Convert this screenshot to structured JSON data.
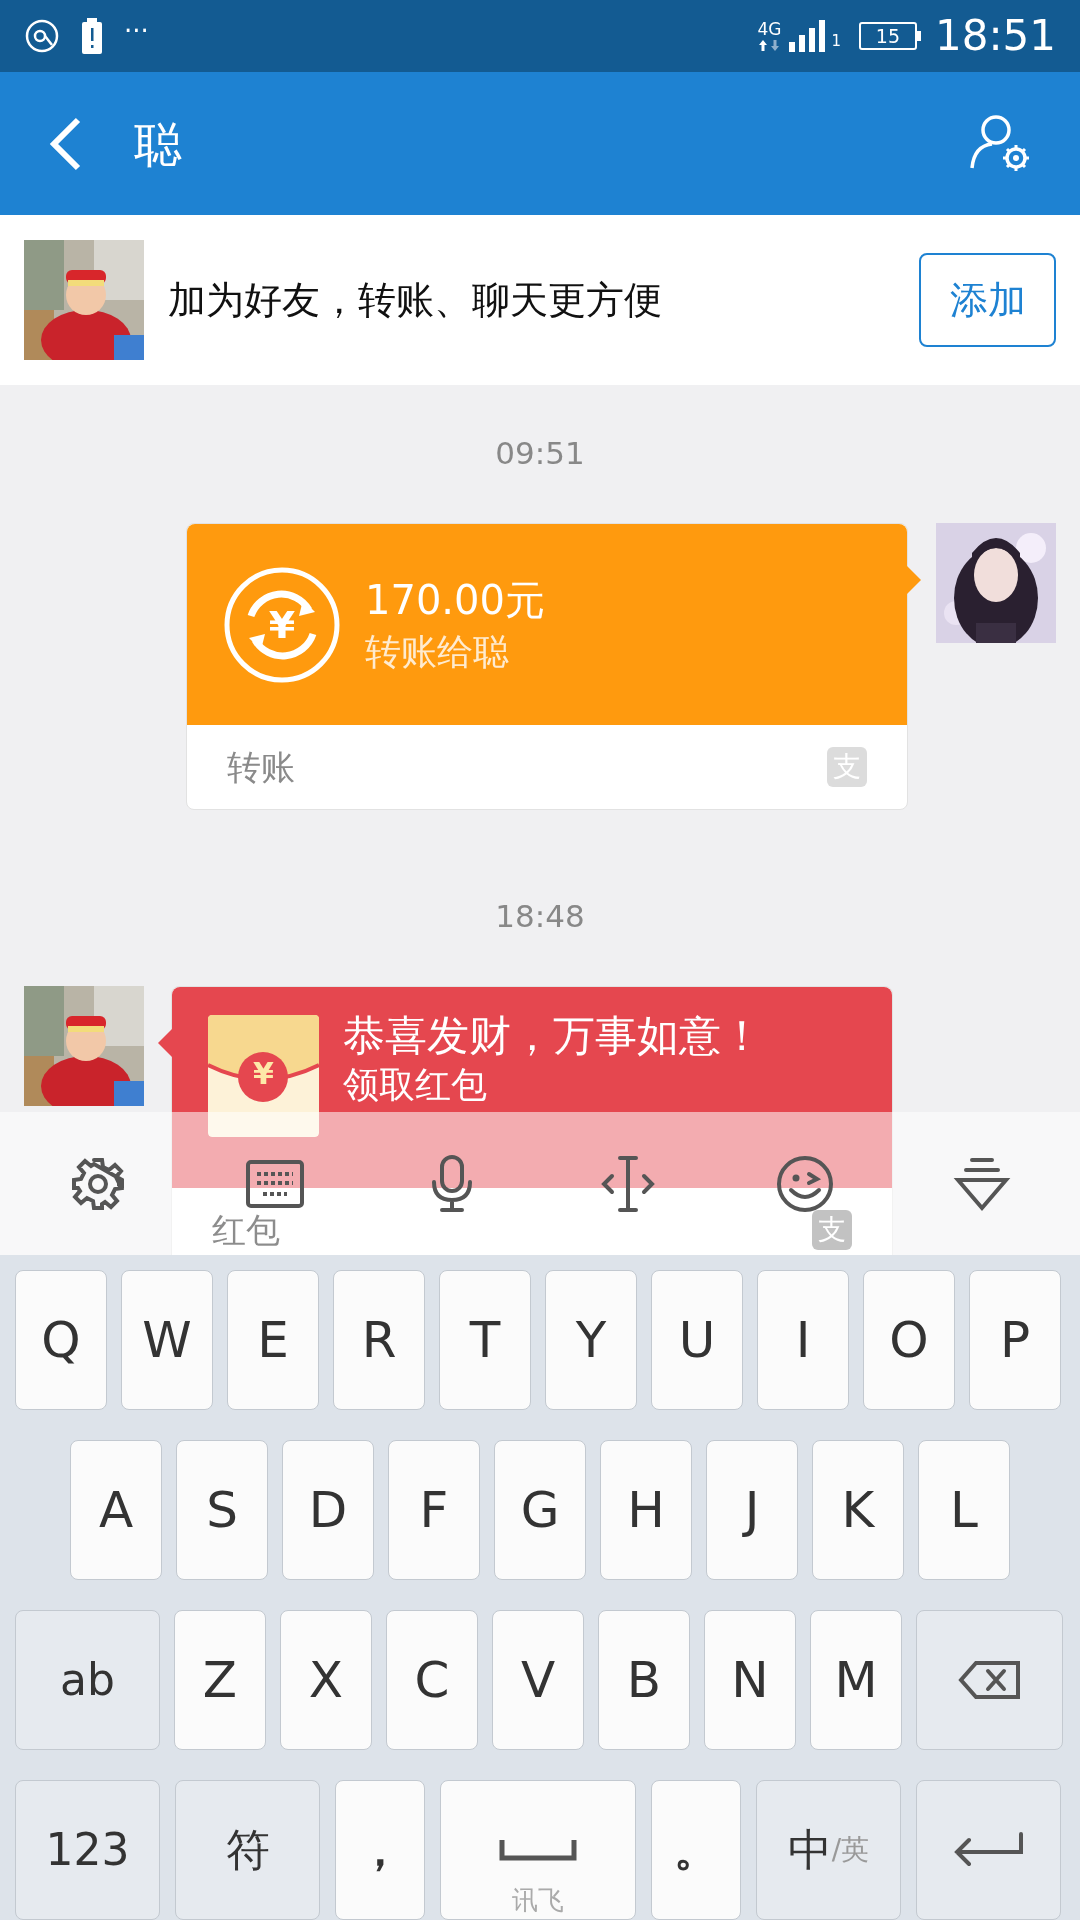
{
  "status_bar": {
    "more": "···",
    "network": "4G",
    "sim": "1",
    "battery": "15",
    "time": "18:51"
  },
  "header": {
    "title": "聪"
  },
  "friend_banner": {
    "text": "加为好友，转账、聊天更方便",
    "button": "添加"
  },
  "messages": [
    {
      "kind": "time",
      "text": "09:51"
    },
    {
      "kind": "transfer",
      "symbol": "¥",
      "amount": "170.00元",
      "note": "转账给聪",
      "footer": "转账",
      "badge": "支"
    },
    {
      "kind": "time",
      "text": "18:48"
    },
    {
      "kind": "red_packet",
      "symbol": "¥",
      "greeting": "恭喜发财，万事如意！",
      "action": "领取红包",
      "footer": "红包",
      "badge": "支"
    }
  ],
  "keyboard": {
    "letter_rows": [
      [
        {
          "kind": "letter",
          "label": "Q"
        },
        {
          "kind": "letter",
          "label": "W"
        },
        {
          "kind": "letter",
          "label": "E"
        },
        {
          "kind": "letter",
          "label": "R"
        },
        {
          "kind": "letter",
          "label": "T"
        },
        {
          "kind": "letter",
          "label": "Y"
        },
        {
          "kind": "letter",
          "label": "U"
        },
        {
          "kind": "letter",
          "label": "I"
        },
        {
          "kind": "letter",
          "label": "O"
        },
        {
          "kind": "letter",
          "label": "P"
        }
      ],
      [
        {
          "kind": "letter",
          "label": "A"
        },
        {
          "kind": "letter",
          "label": "S"
        },
        {
          "kind": "letter",
          "label": "D"
        },
        {
          "kind": "letter",
          "label": "F"
        },
        {
          "kind": "letter",
          "label": "G"
        },
        {
          "kind": "letter",
          "label": "H"
        },
        {
          "kind": "letter",
          "label": "J"
        },
        {
          "kind": "letter",
          "label": "K"
        },
        {
          "kind": "letter",
          "label": "L"
        }
      ],
      [
        {
          "kind": "function",
          "label": "ab"
        },
        {
          "kind": "letter",
          "label": "Z"
        },
        {
          "kind": "letter",
          "label": "X"
        },
        {
          "kind": "letter",
          "label": "C"
        },
        {
          "kind": "letter",
          "label": "V"
        },
        {
          "kind": "letter",
          "label": "B"
        },
        {
          "kind": "letter",
          "label": "N"
        },
        {
          "kind": "letter",
          "label": "M"
        },
        {
          "kind": "backspace"
        }
      ]
    ],
    "bottom_row": [
      {
        "kind": "function",
        "label": "123"
      },
      {
        "kind": "function",
        "label": "符"
      },
      {
        "kind": "punct",
        "label": "，"
      },
      {
        "kind": "space",
        "label": "讯飞"
      },
      {
        "kind": "punct",
        "label": "。"
      },
      {
        "kind": "lang",
        "label": "中",
        "sub": "/英"
      },
      {
        "kind": "enter"
      }
    ]
  }
}
